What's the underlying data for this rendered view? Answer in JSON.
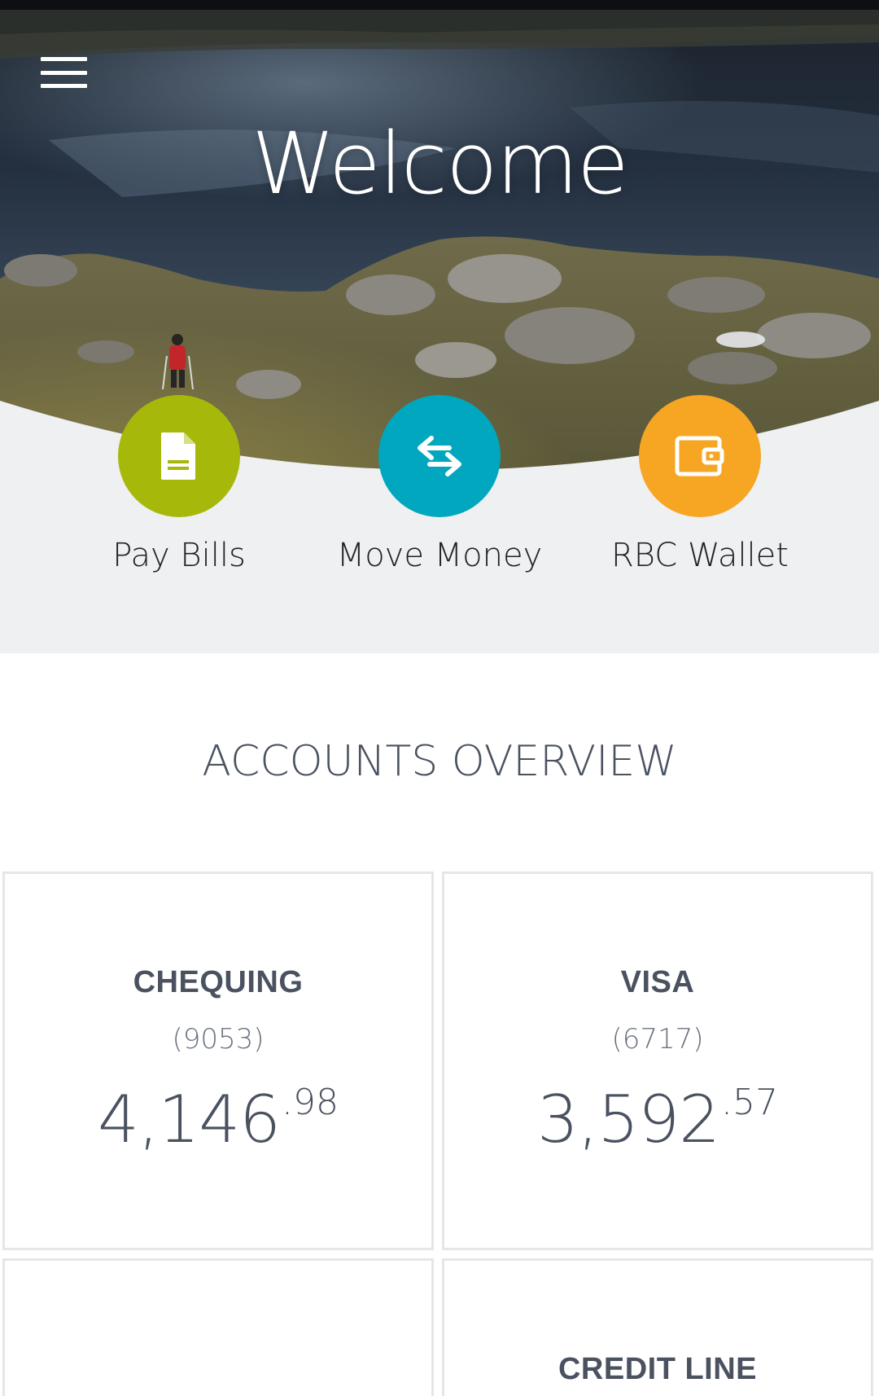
{
  "header": {
    "title": "Welcome",
    "menu_icon": "hamburger-menu-icon"
  },
  "quick_actions": [
    {
      "label": "Pay Bills",
      "icon": "bill-document-icon",
      "color": "#a6b90b"
    },
    {
      "label": "Move Money",
      "icon": "transfer-arrows-icon",
      "color": "#00a7be"
    },
    {
      "label": "RBC Wallet",
      "icon": "wallet-icon",
      "color": "#f6a623"
    }
  ],
  "accounts_overview": {
    "title": "ACCOUNTS OVERVIEW",
    "accounts": [
      {
        "name": "CHEQUING",
        "number": "(9053)",
        "balance_whole": "4,146",
        "balance_cents": ".98"
      },
      {
        "name": "VISA",
        "number": "(6717)",
        "balance_whole": "3,592",
        "balance_cents": ".57"
      },
      {
        "name": "",
        "number": "",
        "balance_whole": "",
        "balance_cents": ""
      },
      {
        "name": "CREDIT LINE",
        "number": "",
        "balance_whole": "",
        "balance_cents": ""
      }
    ]
  },
  "colors": {
    "panel_background": "#eef0f2",
    "text_primary": "#4a5260",
    "card_border": "#e4e6e8"
  }
}
